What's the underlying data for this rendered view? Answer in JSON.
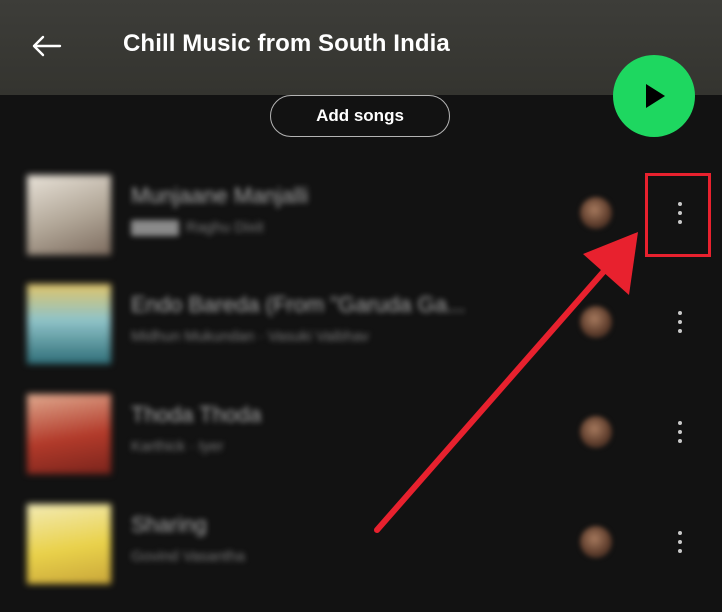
{
  "header": {
    "title": "Chill Music from South India",
    "background_color": "#3a3a35",
    "back_icon": "arrow-left-icon"
  },
  "play_button": {
    "icon": "play-icon",
    "color": "#1ed760"
  },
  "add_songs": {
    "label": "Add songs"
  },
  "tracks": [
    {
      "title": "Munjaane Manjalli",
      "explicit_badge": "",
      "artist": "Raghu Dixit",
      "cover_colors": [
        "#e8e2d8",
        "#b0a596",
        "#7c6b5e"
      ]
    },
    {
      "title": "Endo Bareda (From \"Garuda Ga...",
      "artist": "Midhun Mukundan · Vasuki Vaibhav",
      "cover_colors": [
        "#d9a441",
        "#6fb7c2",
        "#2f6e78"
      ]
    },
    {
      "title": "Thoda Thoda",
      "artist": "Karthick · Iyer",
      "cover_colors": [
        "#e0aa8f",
        "#b23a2a",
        "#7a241c"
      ]
    },
    {
      "title": "Sharing",
      "artist": "Govind Vasantha",
      "cover_colors": [
        "#f3ebb5",
        "#e9d14a",
        "#c9a63a"
      ]
    }
  ],
  "track_more_icon": "more-vertical-icon",
  "annotation": {
    "color": "#e8212e"
  }
}
